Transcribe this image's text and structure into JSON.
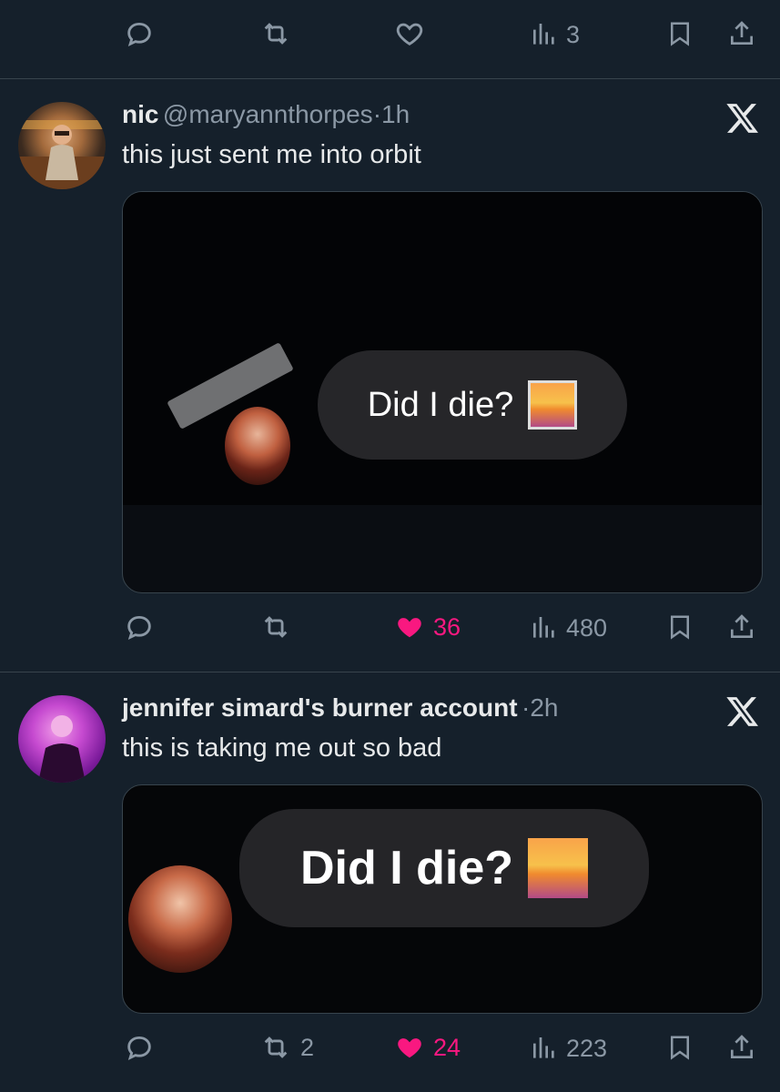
{
  "top_actions": {
    "views_count": "3"
  },
  "tweets": [
    {
      "name": "nic",
      "handle": "@maryannthorpes",
      "separator": "·",
      "time": "1h",
      "text": "this just sent me into orbit",
      "media": {
        "bubble_text": "Did I die?"
      },
      "actions": {
        "retweets": "",
        "likes": "36",
        "views": "480"
      }
    },
    {
      "name": "jennifer simard's burner account",
      "handle": "",
      "separator": "·",
      "time": "2h",
      "text": "this is taking me out so bad",
      "media": {
        "bubble_text": "Did I die?"
      },
      "actions": {
        "retweets": "2",
        "likes": "24",
        "views": "223"
      }
    }
  ],
  "colors": {
    "background": "#15202b",
    "like_pink": "#f91880",
    "muted": "#8b98a5",
    "text": "#e7e9ea"
  }
}
